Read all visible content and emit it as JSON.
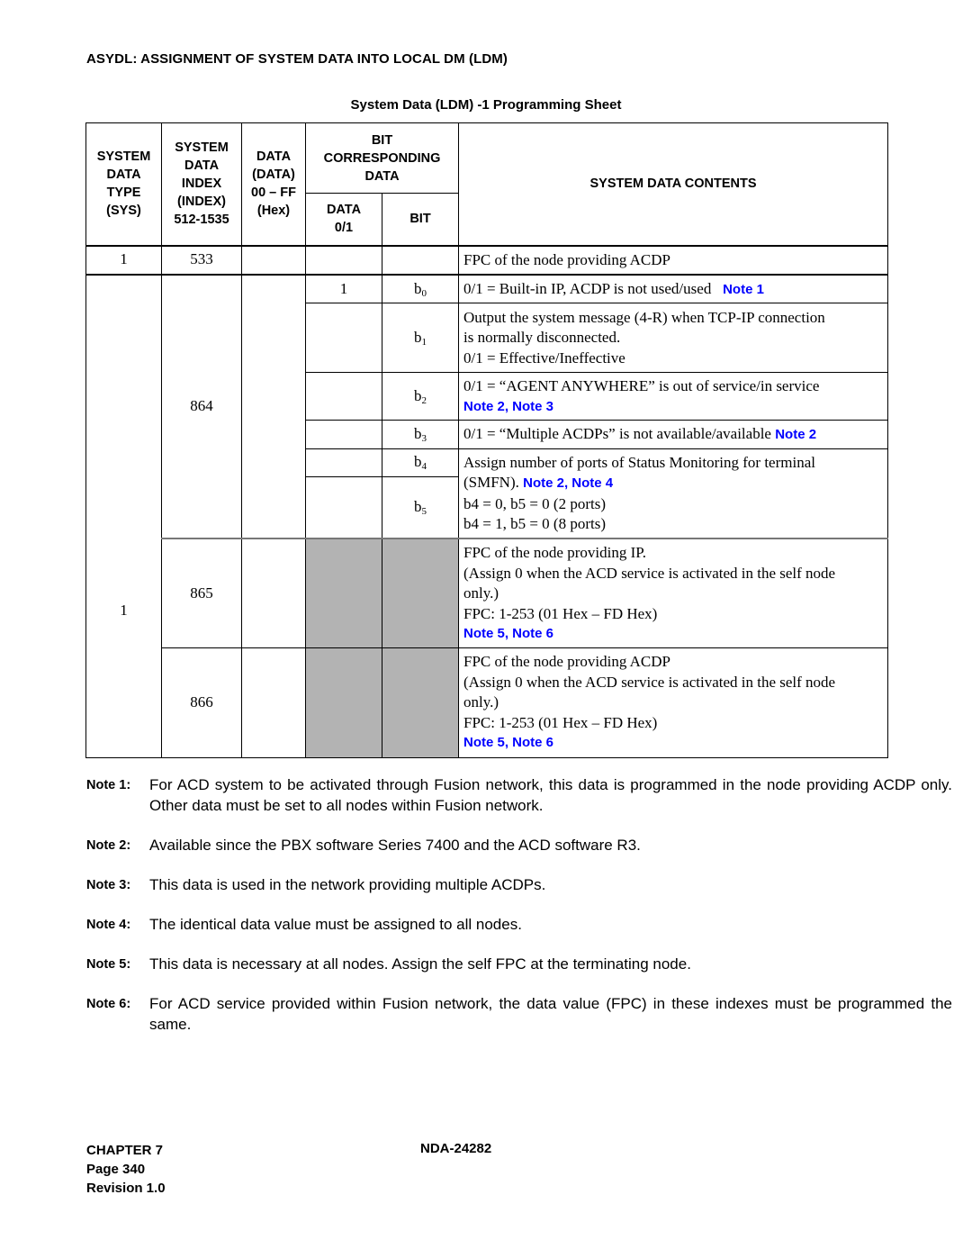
{
  "document": {
    "heading": "ASYDL: ASSIGNMENT OF SYSTEM DATA INTO LOCAL DM (LDM)",
    "sheet_title": "System Data (LDM) -1 Programming Sheet"
  },
  "table": {
    "headers": {
      "sys": [
        "SYSTEM",
        "DATA",
        "TYPE",
        "(SYS)"
      ],
      "index": [
        "SYSTEM",
        "DATA",
        "INDEX",
        "(INDEX)",
        "512-1535"
      ],
      "data": [
        "DATA",
        "(DATA)",
        "00 – FF",
        "(Hex)"
      ],
      "bit_group": [
        "BIT",
        "CORRESPONDING",
        "DATA"
      ],
      "data01": [
        "DATA",
        "0/1"
      ],
      "bit": "BIT",
      "contents": "SYSTEM DATA CONTENTS"
    },
    "row_533": {
      "sys": "1",
      "index": "533",
      "contents": "FPC of the node providing ACDP"
    },
    "group_864": {
      "sys": "1",
      "index": "864",
      "bits": [
        {
          "data01": "1",
          "bit": "b",
          "bit_sub": "0",
          "text": "0/1 = Built-in IP, ACDP is not used/used",
          "notes": "Note 1"
        },
        {
          "data01": "",
          "bit": "b",
          "bit_sub": "1",
          "lines": [
            "Output the system message (4-R) when TCP-IP connection",
            "is normally disconnected.",
            "0/1 = Effective/Ineffective"
          ]
        },
        {
          "data01": "",
          "bit": "b",
          "bit_sub": "2",
          "text": "0/1 = “AGENT ANYWHERE” is out of service/in service",
          "notes": "Note 2, Note 3"
        },
        {
          "data01": "",
          "bit": "b",
          "bit_sub": "3",
          "text": "0/1 = “Multiple ACDPs” is not available/available",
          "notes": "Note 2"
        },
        {
          "data01": "",
          "bit": "b",
          "bit_sub": "4"
        },
        {
          "data01": "",
          "bit": "b",
          "bit_sub": "5"
        }
      ],
      "b4b5_text": {
        "line1": "Assign number of ports of Status Monitoring for terminal",
        "line2": "(SMFN).",
        "notes": "Note 2, Note 4",
        "line3": "b4 = 0, b5 = 0 (2 ports)",
        "line4": "b4 = 1, b5 = 0 (8 ports)"
      }
    },
    "row_865": {
      "index": "865",
      "lines": [
        "FPC of the node providing IP.",
        "(Assign 0 when the ACD service is activated in the self node",
        "only.)",
        "FPC: 1-253 (01 Hex – FD Hex)"
      ],
      "notes": "Note 5, Note 6"
    },
    "row_866": {
      "index": "866",
      "lines": [
        "FPC of the node providing ACDP",
        "(Assign 0 when the ACD service is activated in the self node",
        "only.)",
        "FPC: 1-253 (01 Hex – FD Hex)"
      ],
      "notes": "Note 5, Note 6"
    }
  },
  "notes": [
    {
      "label": "Note 1:",
      "text": "For ACD system to be activated through Fusion network, this data is programmed in the node providing ACDP only. Other data must be set to all nodes within Fusion network."
    },
    {
      "label": "Note 2:",
      "text": "Available since the PBX software Series 7400 and the ACD software R3."
    },
    {
      "label": "Note 3:",
      "text": "This data is used in the network providing multiple ACDPs."
    },
    {
      "label": "Note 4:",
      "text": "The identical data value must be assigned to all nodes."
    },
    {
      "label": "Note 5:",
      "text": "This data is necessary at all nodes. Assign the self FPC at the terminating node."
    },
    {
      "label": "Note 6:",
      "text": "For ACD service provided within Fusion network, the data value (FPC) in these indexes must be programmed the same."
    }
  ],
  "footer": {
    "chapter": "CHAPTER 7",
    "page": "Page 340",
    "revision": "Revision 1.0",
    "doc_number": "NDA-24282"
  },
  "colors": {
    "note_link": "#0000ff",
    "shaded_cell": "#b3b3b3"
  }
}
